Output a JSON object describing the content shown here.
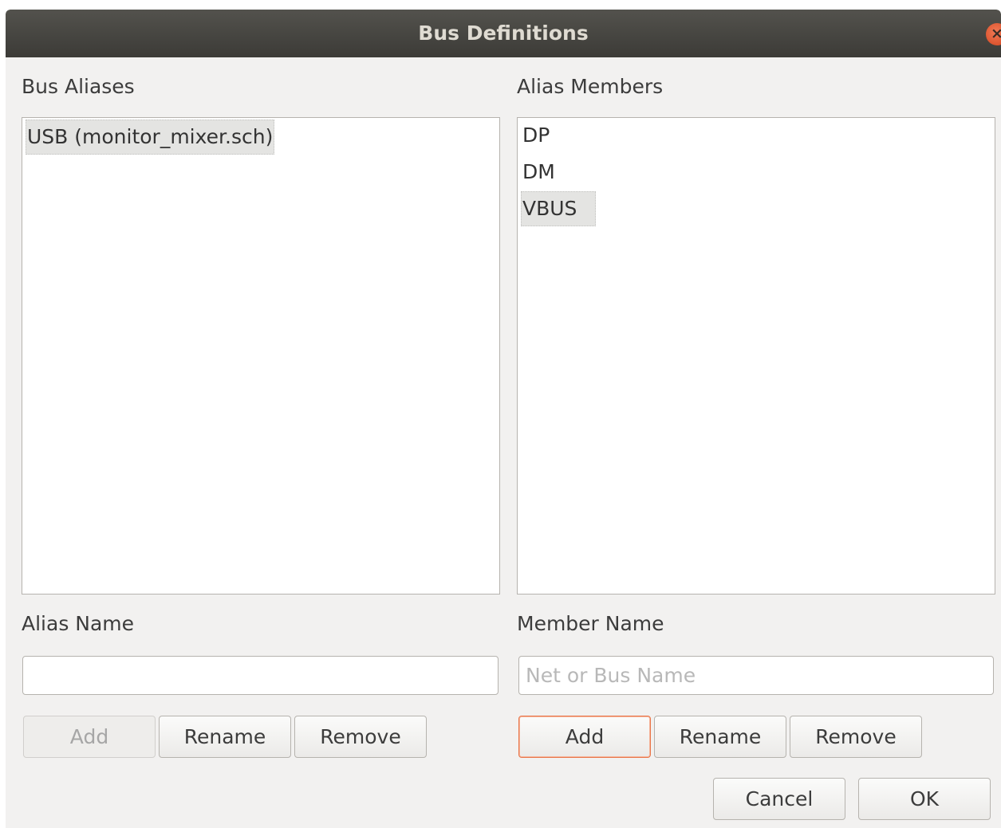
{
  "window": {
    "title": "Bus Definitions",
    "close_icon": "×"
  },
  "aliases": {
    "section_label": "Bus Aliases",
    "items": [
      {
        "label": "USB (monitor_mixer.sch)",
        "selected": true
      }
    ],
    "name_label": "Alias Name",
    "name_value": "",
    "name_placeholder": "",
    "add_label": "Add",
    "rename_label": "Rename",
    "remove_label": "Remove"
  },
  "members": {
    "section_label": "Alias Members",
    "items": [
      {
        "label": "DP",
        "selected": false
      },
      {
        "label": "DM",
        "selected": false
      },
      {
        "label": "VBUS",
        "selected": true
      }
    ],
    "name_label": "Member Name",
    "name_value": "",
    "name_placeholder": "Net or Bus Name",
    "add_label": "Add",
    "rename_label": "Rename",
    "remove_label": "Remove"
  },
  "footer": {
    "cancel_label": "Cancel",
    "ok_label": "OK"
  },
  "colors": {
    "titlebar": "#3c3b37",
    "close_button": "#e05a32",
    "focus_accent": "#e9764a",
    "selection": "#e4e4e2"
  }
}
